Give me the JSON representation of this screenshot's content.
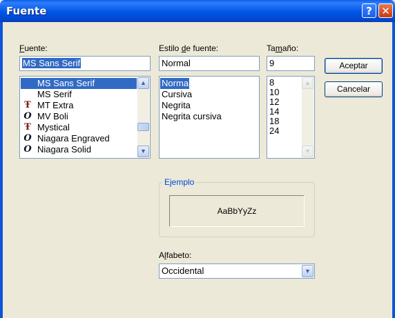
{
  "window": {
    "title": "Fuente",
    "help_symbol": "?",
    "close_symbol": "✕"
  },
  "font": {
    "label_prefix": "F",
    "label_rest": "uente:",
    "input_value": "MS Sans Serif",
    "items": [
      {
        "name": "MS Sans Serif",
        "icon": "",
        "selected": true
      },
      {
        "name": "MS Serif",
        "icon": ""
      },
      {
        "name": "MT Extra",
        "icon": "truetype-font-icon",
        "glyph": "Ŧ"
      },
      {
        "name": "MV Boli",
        "icon": "opentype-font-icon",
        "glyph": "O"
      },
      {
        "name": "Mystical",
        "icon": "truetype-font-icon",
        "glyph": "Ŧ"
      },
      {
        "name": "Niagara Engraved",
        "icon": "opentype-font-icon",
        "glyph": "O"
      },
      {
        "name": "Niagara Solid",
        "icon": "opentype-font-icon",
        "glyph": "O"
      }
    ]
  },
  "style": {
    "label_pre": "Estilo ",
    "label_accel": "d",
    "label_post": "e fuente:",
    "input_value": "Normal",
    "items": [
      "Normal",
      "Cursiva",
      "Negrita",
      "Negrita cursiva"
    ]
  },
  "size": {
    "label_pre": "Ta",
    "label_accel": "m",
    "label_post": "año:",
    "input_value": "9",
    "items": [
      "8",
      "10",
      "12",
      "14",
      "18",
      "24"
    ]
  },
  "buttons": {
    "ok": "Aceptar",
    "cancel": "Cancelar"
  },
  "sample": {
    "legend": "Ejemplo",
    "text": "AaBbYyZz"
  },
  "script": {
    "label_pre": "A",
    "label_accel": "l",
    "label_post": "fabeto:",
    "value": "Occidental"
  },
  "colors": {
    "titlebar": "#0055e5",
    "selection": "#316ac5",
    "dialog_bg": "#ece9d8"
  }
}
